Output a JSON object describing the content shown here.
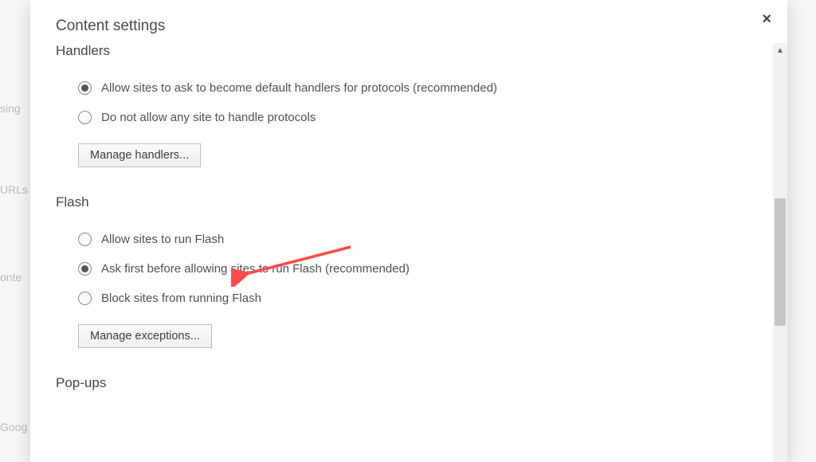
{
  "background": {
    "t1": "sing",
    "t2": "URLs",
    "t3": "onte",
    "t4": "Goog"
  },
  "dialog": {
    "title": "Content settings",
    "close": "×"
  },
  "sections": {
    "handlers": {
      "heading": "Handlers",
      "options": [
        "Allow sites to ask to become default handlers for protocols (recommended)",
        "Do not allow any site to handle protocols"
      ],
      "selected": 0,
      "button": "Manage handlers..."
    },
    "flash": {
      "heading": "Flash",
      "options": [
        "Allow sites to run Flash",
        "Ask first before allowing sites to run Flash (recommended)",
        "Block sites from running Flash"
      ],
      "selected": 1,
      "button": "Manage exceptions..."
    },
    "popups": {
      "heading": "Pop-ups"
    }
  }
}
